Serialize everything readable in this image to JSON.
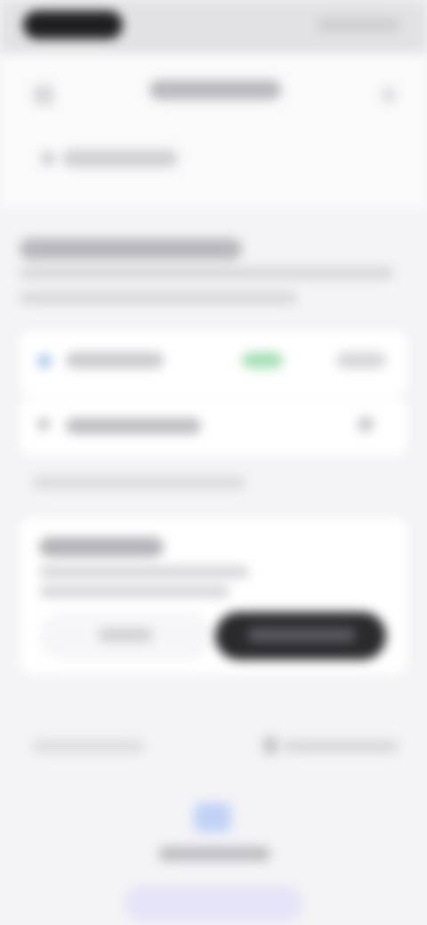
{
  "header": {
    "title": ""
  },
  "top_row": {
    "label": ""
  },
  "section": {
    "title": "",
    "description_line1": "",
    "description_line2": ""
  },
  "account_card": {
    "label": "",
    "status": "",
    "action": ""
  },
  "option_card": {
    "label": ""
  },
  "hint": "",
  "notice": {
    "title": "",
    "body_line1": "",
    "body_line2": "",
    "secondary_button": "",
    "primary_button": ""
  },
  "footer": {
    "left_link": "",
    "right_link": ""
  },
  "bottom": {
    "caption": ""
  },
  "colors": {
    "accent_dark": "#2a2a2e",
    "status_green": "#a4e0b6",
    "bottom_blue": "#c2d2f5",
    "home_lavender": "#e5e3f7"
  },
  "icons": {
    "back": "back-arrow-icon",
    "close": "close-icon",
    "account": "account-icon",
    "option": "settings-icon",
    "chevron": "chevron-right-icon",
    "lock": "lock-icon",
    "bottom": "app-icon"
  }
}
